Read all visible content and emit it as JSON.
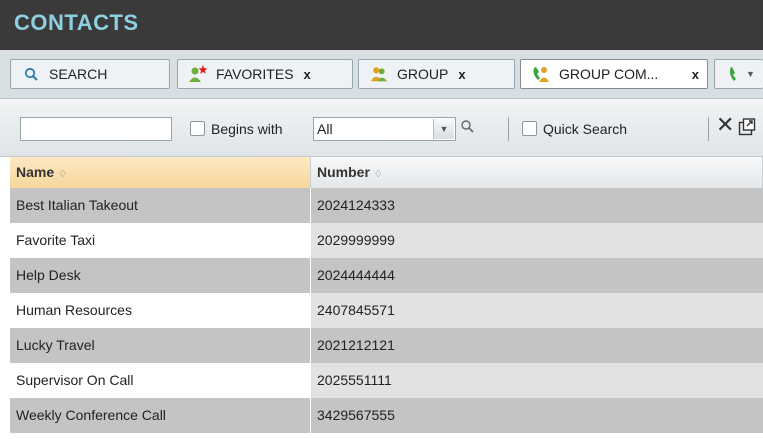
{
  "title": "CONTACTS",
  "tabs": [
    {
      "label": "SEARCH",
      "icon": "search-icon",
      "closable": false
    },
    {
      "label": "FAVORITES",
      "icon": "favorites-icon",
      "closable": true,
      "close": "x"
    },
    {
      "label": "GROUP",
      "icon": "group-icon",
      "closable": true,
      "close": "x"
    },
    {
      "label": "GROUP COM...",
      "icon": "group-common-icon",
      "closable": true,
      "close": "x",
      "active": true
    }
  ],
  "toolbar": {
    "search_value": "",
    "begins_with_label": "Begins with",
    "filter_value": "All",
    "quick_search_label": "Quick Search"
  },
  "columns": {
    "name": "Name",
    "number": "Number",
    "sort_glyph": "♢"
  },
  "rows": [
    {
      "name": "Best Italian Takeout",
      "number": "2024124333"
    },
    {
      "name": "Favorite Taxi",
      "number": "2029999999"
    },
    {
      "name": "Help Desk",
      "number": "2024444444"
    },
    {
      "name": "Human Resources",
      "number": "2407845571"
    },
    {
      "name": "Lucky Travel",
      "number": "2021212121"
    },
    {
      "name": "Supervisor On Call",
      "number": "2025551111"
    },
    {
      "name": "Weekly Conference Call",
      "number": "3429567555"
    }
  ],
  "colors": {
    "title_bar": "#3a3a3a",
    "title_text": "#8fd0e0",
    "selected_header": "#f6d79c",
    "row_shade": "#c4c4c4"
  }
}
